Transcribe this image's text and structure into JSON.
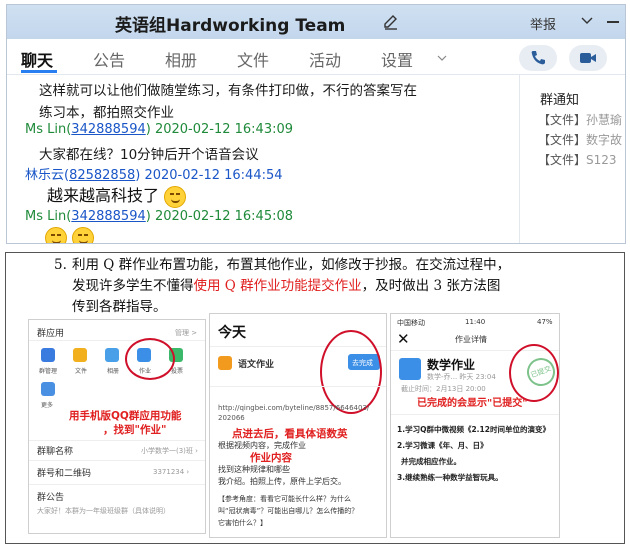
{
  "window": {
    "title": "英语组Hardworking Team",
    "report": "举报"
  },
  "tabs": [
    {
      "label": "聊天"
    },
    {
      "label": "公告"
    },
    {
      "label": "相册"
    },
    {
      "label": "文件"
    },
    {
      "label": "活动"
    },
    {
      "label": "设置"
    }
  ],
  "messages": {
    "text1_line1": "这样就可以让他们做随堂练习，有条件打印做，不行的答案写在",
    "text1_line2": "练习本，都拍照交作业",
    "m2_name": "Ms Lin(",
    "m2_qq": "342888594",
    "m2_time": ") 2020-02-12 16:43:09",
    "text2": "大家都在线？10分钟后开个语音会议",
    "m3_name": "林乐云(",
    "m3_qq": "82582858",
    "m3_time": ") 2020-02-12 16:44:54",
    "text3": "越来越高科技了",
    "m4_name": "Ms Lin(",
    "m4_qq": "342888594",
    "m4_time": ") 2020-02-12 16:45:08"
  },
  "side": {
    "title": "群通知",
    "files": [
      {
        "tag": "【文件】",
        "name": "孙慧瑜"
      },
      {
        "tag": "【文件】",
        "name": "数字故"
      },
      {
        "tag": "【文件】",
        "name": "S123"
      }
    ]
  },
  "doc": {
    "num": "5.",
    "line1": "利用 Q 群作业布置功能，布置其他作业，如修改于抄报。在交流过程中，",
    "line2_a": "发现许多学生不懂得",
    "line2_red": "使用 Q 群作业功能提交作业",
    "line2_b": "，及时做出 3 张方法图",
    "line3": "传到各群指导。"
  },
  "shot1": {
    "header": "群应用",
    "manage": "管理 >",
    "apps": [
      "群管理",
      "文件",
      "相册",
      "作业",
      "投票",
      "更多"
    ],
    "caption1": "用手机版QQ群应用功能",
    "caption2": "，找到\"作业\"",
    "row1_label": "群聊名称",
    "row1_value": "小学数学一(3)班 ›",
    "row2_label": "群号和二维码",
    "row2_value": "3371234 ›",
    "row3_label": "群公告",
    "notice": "大家好！本群为一年级班级群（具体说明）"
  },
  "shot2": {
    "date": "今天",
    "item": "语文作业",
    "btn": "去完成",
    "url": "http://qingbei.com/byteline/8857/6646403/",
    "url2": "202066",
    "caption1": "点进去后，看具体语数英",
    "caption2": "作业内容",
    "body1": "根据视频内容，完成作业",
    "body2": "找到这种规律和哪些",
    "body3": "我介绍。拍照上传，原件上学后交。",
    "ref1": "【参考角度：看看它可能长什么样？为什么",
    "ref2": "叫“冠状病毒”？可能出自哪儿？怎么传播的？",
    "ref3": "它害怕什么？】"
  },
  "shot3": {
    "status_left": "中国移动",
    "status_time": "11:40",
    "status_right": "47%",
    "nav_title": "作业详情",
    "hw_title": "数学作业",
    "hw_sub": "数学-乔... 昨天 23:04",
    "hw_deadline": "截止时间：2月13日 20:00",
    "caption": "已完成的会显示\"已提交\"",
    "stamp": "已提交",
    "task1": "1.学习Q群中微视频《2.12时间单位的演变》",
    "task2": "2.学习微课《年、月、日》",
    "task3": "并完成相应作业。",
    "task4": "3.继续熟练一种数学益智玩具。"
  },
  "colors": {
    "accent": "#2a7ff0",
    "green_name": "#1f8a3a",
    "blue_name": "#1a56c7",
    "highlight_red": "#e02020"
  }
}
